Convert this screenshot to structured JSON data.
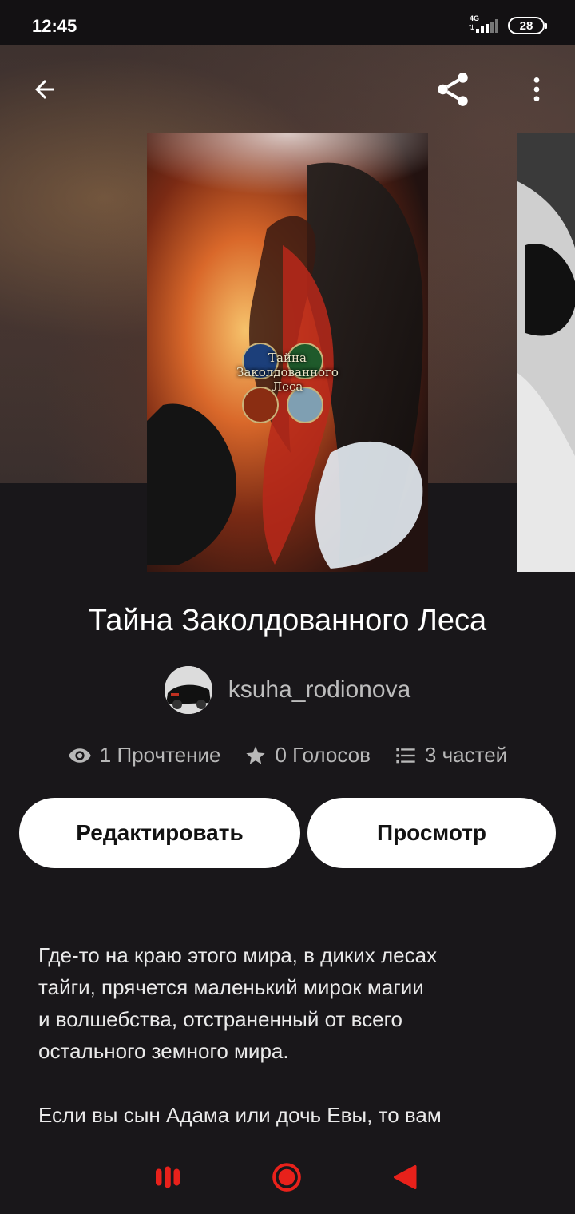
{
  "status_bar": {
    "time": "12:45",
    "network": "4G",
    "battery": "28"
  },
  "nav": {
    "back_icon": "arrow-back-icon",
    "share_icon": "share-icon",
    "more_icon": "more-vert-icon"
  },
  "cover": {
    "title_line1": "Тайна",
    "title_line2": "Заколдованного",
    "title_line3": "Леса"
  },
  "story": {
    "title": "Тайна Заколдованного Леса",
    "author": "ksuha_rodionova",
    "reads": "1 Прочтение",
    "votes": "0 Голосов",
    "parts": "3 частей"
  },
  "buttons": {
    "edit": "Редактировать",
    "preview": "Просмотр"
  },
  "description": {
    "paragraph1_line1": "Где-то на краю этого мира, в диких лесах",
    "paragraph1_line2": "тайги, прячется маленький мирок магии",
    "paragraph1_line3": "и волшебства, отстраненный от всего",
    "paragraph1_line4": "остального земного мира.",
    "paragraph2_line1": "Если вы сын Адама или дочь Евы, то вам"
  },
  "bottom_bar": {
    "icons": [
      "recent-apps-icon",
      "home-icon",
      "back-icon"
    ],
    "accent": "#e8211b"
  }
}
